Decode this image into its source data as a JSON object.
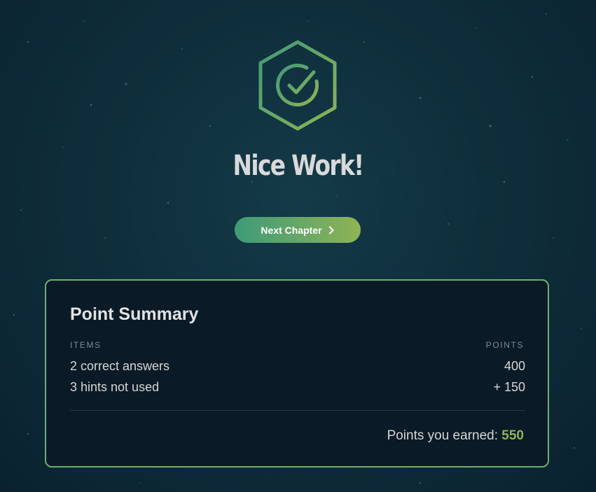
{
  "result": {
    "title": "Nice Work!",
    "badge_icon": "check-circle-hexagon-icon",
    "next_button_label": "Next Chapter",
    "next_button_icon": "chevron-right-icon"
  },
  "summary": {
    "heading": "Point Summary",
    "columns": {
      "items": "ITEMS",
      "points": "POINTS"
    },
    "rows": [
      {
        "item": "2 correct answers",
        "points": "400"
      },
      {
        "item": "3 hints not used",
        "points": "+ 150"
      }
    ],
    "total_label": "Points you earned:",
    "total_value": "550"
  },
  "colors": {
    "accent_green": "#8fb453",
    "accent_teal": "#3f9a78",
    "background": "#0f2e3b",
    "card_border": "#6fae72"
  }
}
